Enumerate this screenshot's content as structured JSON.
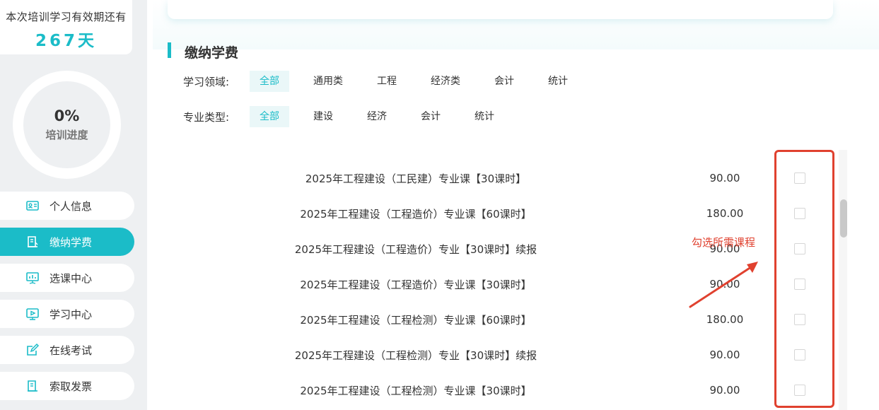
{
  "sidebar": {
    "validity_label": "本次培训学习有效期还有",
    "validity_days": "267天",
    "progress_value": "0%",
    "progress_label": "培训进度",
    "nav": [
      {
        "label": "个人信息",
        "icon": "id-card-icon",
        "active": false
      },
      {
        "label": "缴纳学费",
        "icon": "payment-receipt-icon",
        "active": true
      },
      {
        "label": "选课中心",
        "icon": "presentation-board-icon",
        "active": false
      },
      {
        "label": "学习中心",
        "icon": "video-play-icon",
        "active": false
      },
      {
        "label": "在线考试",
        "icon": "edit-pen-icon",
        "active": false
      },
      {
        "label": "索取发票",
        "icon": "invoice-icon",
        "active": false
      }
    ]
  },
  "main": {
    "section_title": "缴纳学费",
    "filters": {
      "domain": {
        "label": "学习领域:",
        "options": [
          "全部",
          "通用类",
          "工程",
          "经济类",
          "会计",
          "统计"
        ],
        "selected": "全部"
      },
      "major": {
        "label": "专业类型:",
        "options": [
          "全部",
          "建设",
          "经济",
          "会计",
          "统计"
        ],
        "selected": "全部"
      }
    },
    "courses": [
      {
        "name": "2025年工程建设（工民建）专业课【30课时】",
        "price": "90.00",
        "checked": false
      },
      {
        "name": "2025年工程建设（工程造价）专业课【60课时】",
        "price": "180.00",
        "checked": false
      },
      {
        "name": "2025年工程建设（工程造价）专业【30课时】续报",
        "price": "90.00",
        "checked": false
      },
      {
        "name": "2025年工程建设（工程造价）专业课【30课时】",
        "price": "90.00",
        "checked": false
      },
      {
        "name": "2025年工程建设（工程检测）专业课【60课时】",
        "price": "180.00",
        "checked": false
      },
      {
        "name": "2025年工程建设（工程检测）专业【30课时】续报",
        "price": "90.00",
        "checked": false
      },
      {
        "name": "2025年工程建设（工程检测）专业课【30课时】",
        "price": "90.00",
        "checked": false
      }
    ],
    "annotation": "勾选所需课程"
  },
  "colors": {
    "accent": "#1bbcc8",
    "annotation": "#e0412f",
    "sidebar_bg": "#eef0f2"
  }
}
